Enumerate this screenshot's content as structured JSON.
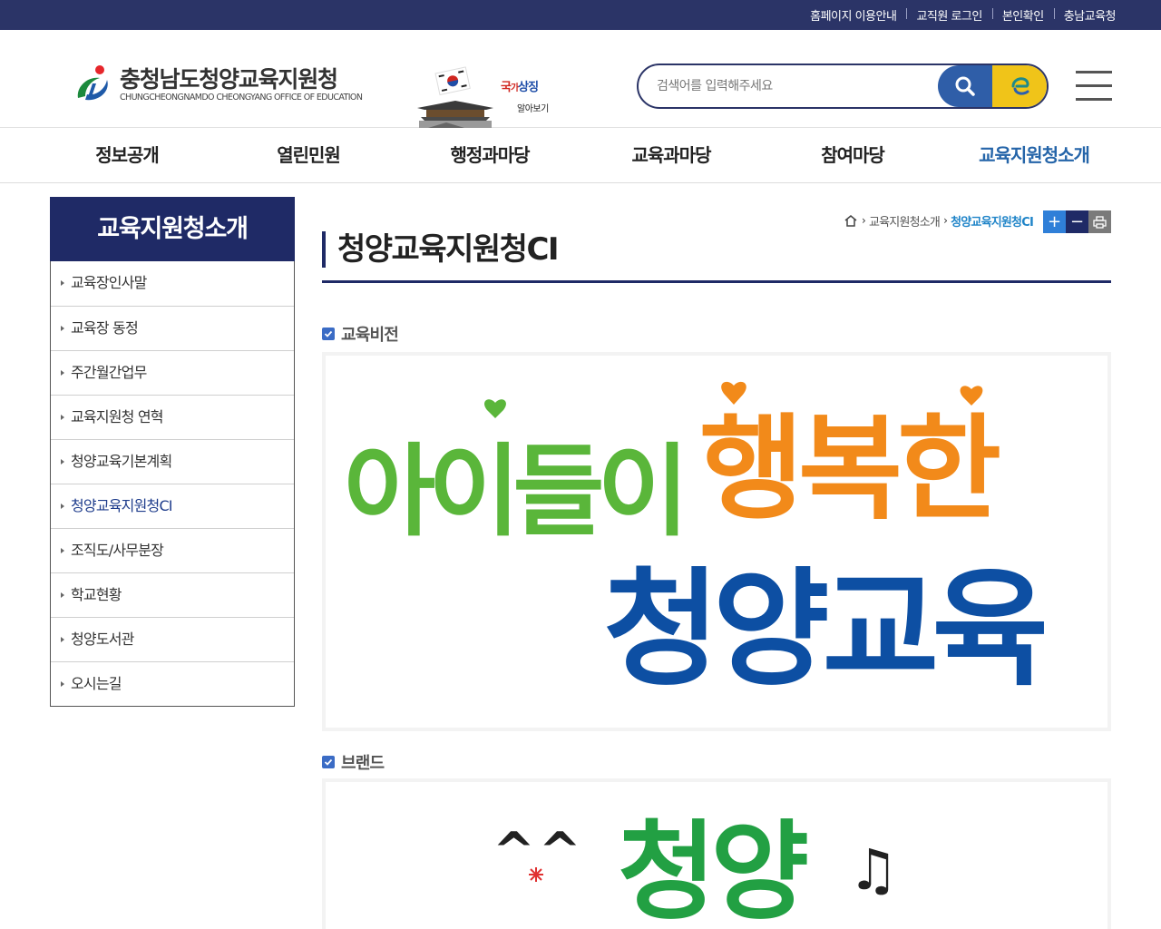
{
  "topbar": {
    "links": [
      "홈페이지 이용안내",
      "교직원 로그인",
      "본인확인",
      "충남교육청"
    ]
  },
  "logo": {
    "title": "충청남도청양교육지원청",
    "subtitle": "CHUNGCHEONGNAMDO CHEONGYANG OFFICE OF EDUCATION"
  },
  "banner": {
    "title_red": "국",
    "title_mid": "가",
    "title_blue": "상징",
    "sub": "알아보기"
  },
  "search": {
    "placeholder": "검색어를 입력해주세요"
  },
  "gnb": {
    "items": [
      "정보공개",
      "열린민원",
      "행정과마당",
      "교육과마당",
      "참여마당",
      "교육지원청소개"
    ]
  },
  "lnb": {
    "title": "교육지원청소개",
    "items": [
      "교육장인사말",
      "교육장 동정",
      "주간월간업무",
      "교육지원청 연혁",
      "청양교육기본계획",
      "청양교육지원청CI",
      "조직도/사무분장",
      "학교현황",
      "청양도서관",
      "오시는길"
    ]
  },
  "breadcrumb": {
    "level1": "교육지원청소개",
    "current": "청양교육지원청CI"
  },
  "page": {
    "title": "청양교육지원청CI"
  },
  "sections": {
    "vision": {
      "title": "교육비전",
      "line1_green": "아이들이",
      "line1_orange": "행복한",
      "line2_blue": "청양교육"
    },
    "brand": {
      "title": "브랜드",
      "emoticon": "^^",
      "wordmark": "청양",
      "music": "♫"
    }
  },
  "colors": {
    "topbar": "#2b3467",
    "navy": "#1f2a66",
    "accent_blue": "#2565a9",
    "vision_green": "#5ab63a",
    "vision_orange": "#f28a1a",
    "vision_blue": "#0d4fa3",
    "brand_green": "#22a043"
  }
}
